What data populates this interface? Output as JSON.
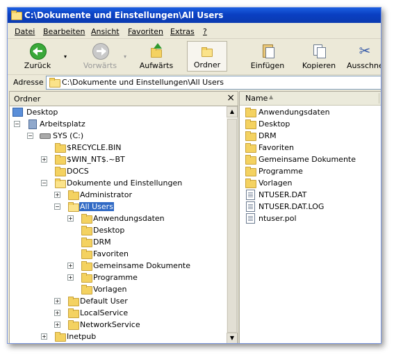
{
  "window": {
    "title": "C:\\Dokumente und Einstellungen\\All Users"
  },
  "menu": [
    {
      "label": "Datei"
    },
    {
      "label": "Bearbeiten"
    },
    {
      "label": "Ansicht"
    },
    {
      "label": "Favoriten"
    },
    {
      "label": "Extras"
    },
    {
      "label": "?"
    }
  ],
  "toolbar": {
    "back": "Zurück",
    "forward": "Vorwärts",
    "up": "Aufwärts",
    "folders": "Ordner",
    "paste": "Einfügen",
    "copy": "Kopieren",
    "cut": "Ausschnei"
  },
  "address": {
    "label": "Adresse",
    "value": "C:\\Dokumente und Einstellungen\\All Users"
  },
  "folders_pane": {
    "title": "Ordner",
    "close": "×",
    "tree": [
      {
        "label": "Desktop"
      },
      {
        "label": "Arbeitsplatz",
        "expander": "−"
      },
      {
        "label": "SYS (C:)",
        "expander": "−"
      },
      {
        "label": "$RECYCLE.BIN"
      },
      {
        "label": "$WIN_NT$.~BT",
        "expander": "+"
      },
      {
        "label": "DOCS"
      },
      {
        "label": "Dokumente und Einstellungen",
        "expander": "−"
      },
      {
        "label": "Administrator",
        "expander": "+"
      },
      {
        "label": "All Users",
        "expander": "−",
        "selected": true
      },
      {
        "label": "Anwendungsdaten",
        "expander": "+"
      },
      {
        "label": "Desktop"
      },
      {
        "label": "DRM"
      },
      {
        "label": "Favoriten"
      },
      {
        "label": "Gemeinsame Dokumente",
        "expander": "+"
      },
      {
        "label": "Programme",
        "expander": "+"
      },
      {
        "label": "Vorlagen"
      },
      {
        "label": "Default User",
        "expander": "+"
      },
      {
        "label": "LocalService",
        "expander": "+"
      },
      {
        "label": "NetworkService",
        "expander": "+"
      },
      {
        "label": "Inetpub",
        "expander": "+"
      }
    ]
  },
  "file_list": {
    "column_name": "Name",
    "sort_indicator": "▲",
    "items": [
      {
        "label": "Anwendungsdaten",
        "type": "folder"
      },
      {
        "label": "Desktop",
        "type": "folder"
      },
      {
        "label": "DRM",
        "type": "folder"
      },
      {
        "label": "Favoriten",
        "type": "folder"
      },
      {
        "label": "Gemeinsame Dokumente",
        "type": "folder"
      },
      {
        "label": "Programme",
        "type": "folder"
      },
      {
        "label": "Vorlagen",
        "type": "folder"
      },
      {
        "label": "NTUSER.DAT",
        "type": "file"
      },
      {
        "label": "NTUSER.DAT.LOG",
        "type": "file"
      },
      {
        "label": "ntuser.pol",
        "type": "file"
      }
    ]
  },
  "colors": {
    "titlebar": "#0a3fc2",
    "selection": "#316ac5",
    "folder": "#f4d261"
  }
}
